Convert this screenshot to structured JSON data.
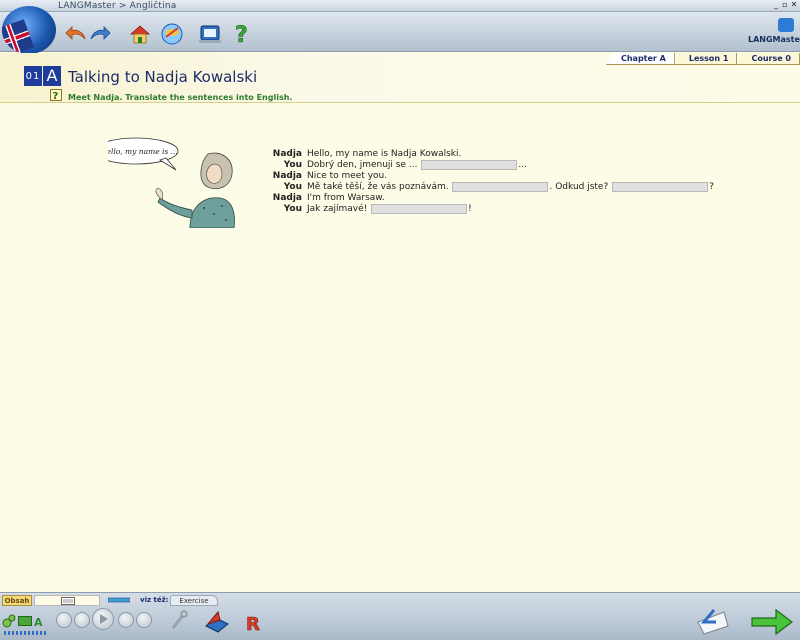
{
  "window": {
    "title": "LANGMaster > Angličtina"
  },
  "toolbar": {
    "buttons": [
      {
        "icon": "back-arrow-icon"
      },
      {
        "icon": "forward-arrow-icon"
      },
      {
        "icon": "home-icon"
      },
      {
        "icon": "globe-tools-icon"
      },
      {
        "icon": "dictionary-icon"
      },
      {
        "icon": "help-icon"
      }
    ],
    "logo_text": "LANGMaster"
  },
  "header": {
    "number": "01",
    "letter": "A",
    "title": "Talking to Nadja Kowalski",
    "instruction": "Meet Nadja. Translate the sentences into English."
  },
  "breadcrumb_tabs": [
    "Chapter A",
    "Lesson 1",
    "Course 0"
  ],
  "illustration": {
    "bubble_text": "Hello, my name is ..."
  },
  "dialogue": [
    {
      "speaker": "Nadja",
      "parts": [
        {
          "text": "Hello, my name is Nadja Kowalski."
        }
      ]
    },
    {
      "speaker": "You",
      "parts": [
        {
          "text": "Dobrý den, jmenuji se ... "
        },
        {
          "gap": true,
          "value": ""
        },
        {
          "text": "..."
        }
      ]
    },
    {
      "speaker": "Nadja",
      "parts": [
        {
          "text": "Nice to meet you."
        }
      ]
    },
    {
      "speaker": "You",
      "parts": [
        {
          "text": "Mě také těší, že vás poznávám. "
        },
        {
          "gap": true,
          "value": ""
        },
        {
          "text": ". Odkud jste? "
        },
        {
          "gap": true,
          "value": ""
        },
        {
          "text": "?"
        }
      ]
    },
    {
      "speaker": "Nadja",
      "parts": [
        {
          "text": "I'm from Warsaw."
        }
      ]
    },
    {
      "speaker": "You",
      "parts": [
        {
          "text": "Jak zajímavé! "
        },
        {
          "gap": true,
          "value": ""
        },
        {
          "text": "!"
        }
      ]
    }
  ],
  "bottom": {
    "obsah_label": "Obsah",
    "viz_label": "viz též:",
    "exercise_label": "Exercise"
  }
}
